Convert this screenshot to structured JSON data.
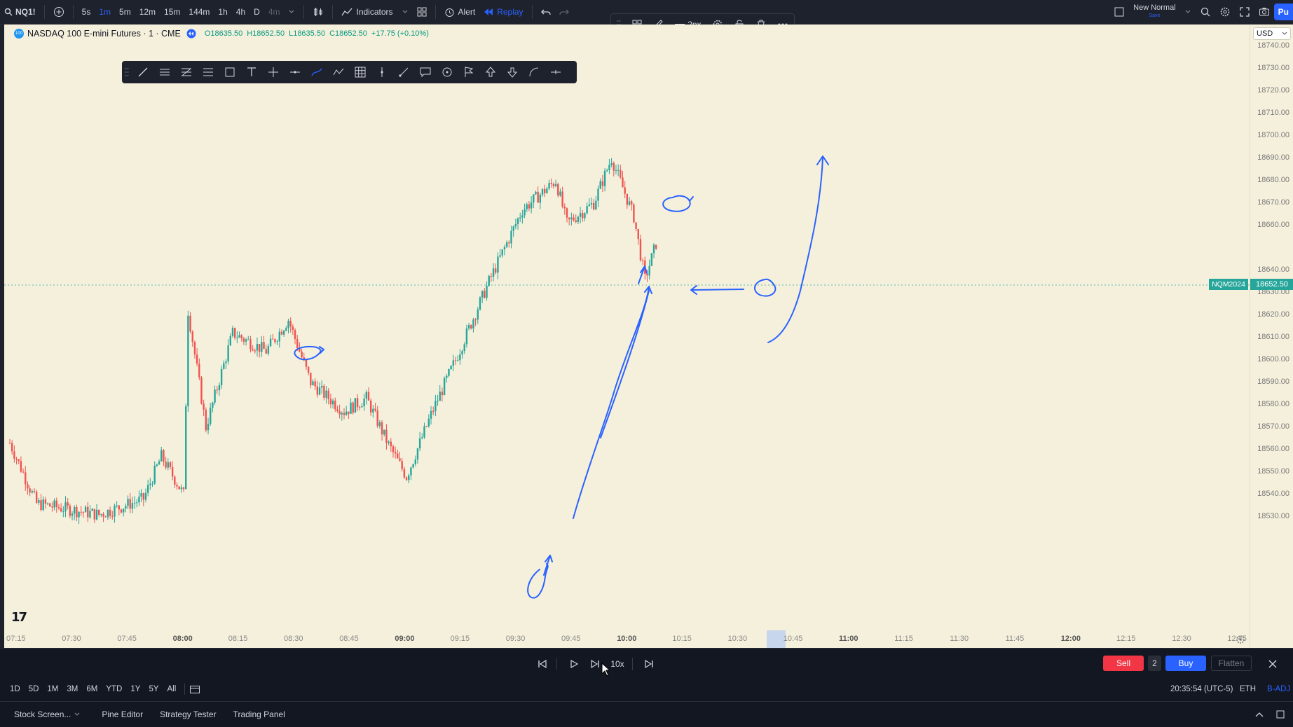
{
  "topbar": {
    "symbol": "NQ1!",
    "intervals": [
      "5s",
      "1m",
      "5m",
      "12m",
      "15m",
      "144m",
      "1h",
      "4h",
      "D",
      "4m"
    ],
    "active_interval": "1m",
    "indicators_label": "Indicators",
    "alert_label": "Alert",
    "replay_label": "Replay",
    "layout_name": "New Normal",
    "layout_sub": "Save",
    "publish_label": "Pu"
  },
  "draw_toolbar": {
    "width_label": "2px"
  },
  "chart": {
    "symbol_name": "NASDAQ 100 E-mini Futures · 1 · CME",
    "ohlc_open": "O18635.50",
    "ohlc_high": "H18652.50",
    "ohlc_low": "L18635.50",
    "ohlc_close": "C18652.50",
    "change": "+17.75 (+0.10%)",
    "currency": "USD",
    "contract_label": "NQM2024",
    "last_price": "18652.50",
    "price_ticks": [
      "18740.00",
      "18730.00",
      "18720.00",
      "18710.00",
      "18700.00",
      "18690.00",
      "18680.00",
      "18670.00",
      "18660.00",
      "18640.00",
      "18630.00",
      "18620.00",
      "18610.00",
      "18600.00",
      "18590.00",
      "18580.00",
      "18570.00",
      "18560.00",
      "18550.00",
      "18540.00",
      "18530.00"
    ],
    "time_ticks": [
      "07:15",
      "07:30",
      "07:45",
      "08:00",
      "08:15",
      "08:30",
      "08:45",
      "09:00",
      "09:15",
      "09:30",
      "09:45",
      "10:00",
      "10:15",
      "10:30",
      "10:45",
      "11:00",
      "11:15",
      "11:30",
      "11:45",
      "12:00",
      "12:15",
      "12:30",
      "12:45"
    ],
    "colors": {
      "up": "#26a69a",
      "down": "#ef5350",
      "drawing": "#2962ff",
      "background": "#f5f0dc"
    }
  },
  "replay": {
    "speed_label": "10x",
    "sell_label": "Sell",
    "qty": "2",
    "buy_label": "Buy",
    "flatten_label": "Flatten"
  },
  "range_bar": {
    "ranges": [
      "1D",
      "5D",
      "1M",
      "3M",
      "6M",
      "YTD",
      "1Y",
      "5Y",
      "All"
    ],
    "clock": "20:35:54 (UTC-5)",
    "session": "ETH",
    "adj": "B-ADJ"
  },
  "bottom_tabs": [
    "Stock Screen...",
    "Pine Editor",
    "Strategy Tester",
    "Trading Panel"
  ]
}
